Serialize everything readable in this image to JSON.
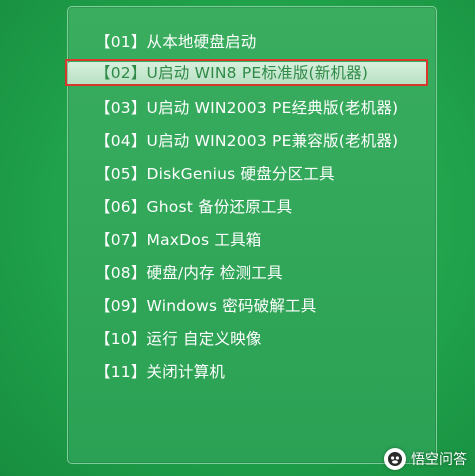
{
  "menu": {
    "items": [
      {
        "label": "【01】从本地硬盘启动"
      },
      {
        "label": "【02】U启动 WIN8 PE标准版(新机器)"
      },
      {
        "label": "【03】U启动 WIN2003 PE经典版(老机器)"
      },
      {
        "label": "【04】U启动 WIN2003 PE兼容版(老机器)"
      },
      {
        "label": "【05】DiskGenius 硬盘分区工具"
      },
      {
        "label": "【06】Ghost 备份还原工具"
      },
      {
        "label": "【07】MaxDos 工具箱"
      },
      {
        "label": "【08】硬盘/内存 检测工具"
      },
      {
        "label": "【09】Windows 密码破解工具"
      },
      {
        "label": "【10】运行 自定义映像"
      },
      {
        "label": "【11】关闭计算机"
      }
    ],
    "selected_index": 1
  },
  "watermark": {
    "text": "悟空问答",
    "logo_icon": "wukong-logo-icon"
  },
  "colors": {
    "background": "#22a64e",
    "panel": "#34aa5a",
    "panel_border": "#7fcd98",
    "selected_bg": "#c9e9d1",
    "selected_text": "#2f8a47",
    "highlight_border": "#d9372d",
    "text": "#ffffff"
  }
}
